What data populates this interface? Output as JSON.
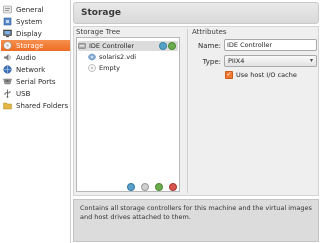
{
  "sidebar": {
    "items": [
      {
        "label": "General",
        "icon": "general-icon",
        "color": "#d9d9d9"
      },
      {
        "label": "System",
        "icon": "system-icon",
        "color": "#5b88c6"
      },
      {
        "label": "Display",
        "icon": "display-icon",
        "color": "#6c6c6c"
      },
      {
        "label": "Storage",
        "icon": "storage-icon",
        "color": "#f2f2f2"
      },
      {
        "label": "Audio",
        "icon": "audio-icon",
        "color": "#777777"
      },
      {
        "label": "Network",
        "icon": "network-icon",
        "color": "#3d72b9"
      },
      {
        "label": "Serial Ports",
        "icon": "serial-ports-icon",
        "color": "#888888"
      },
      {
        "label": "USB",
        "icon": "usb-icon",
        "color": "#555555"
      },
      {
        "label": "Shared Folders",
        "icon": "shared-folders-icon",
        "color": "#e3b545"
      }
    ],
    "active_index": 3,
    "active_color": "#ed6c24"
  },
  "header": {
    "title": "Storage"
  },
  "storage_tree": {
    "label": "Storage Tree",
    "controller": "IDE Controller",
    "devices": [
      {
        "label": "solaris2.vdi",
        "icon": "hard-disk-icon"
      },
      {
        "label": "Empty",
        "icon": "cd-dvd-icon"
      }
    ]
  },
  "attributes": {
    "label": "Attributes",
    "name_label": "Name:",
    "name_value": "IDE Controller",
    "type_label": "Type:",
    "type_value": "PIIX4",
    "host_io_label": "Use host I/O cache",
    "host_io_checked": true
  },
  "description": "Contains all storage controllers for this machine and the virtual images and host drives attached to them."
}
